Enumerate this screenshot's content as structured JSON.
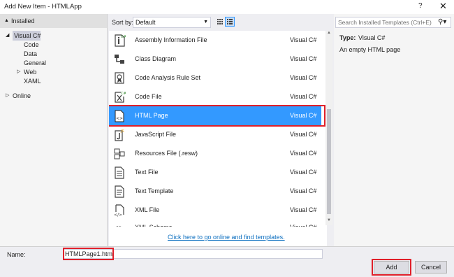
{
  "window": {
    "title": "Add New Item - HTMLApp",
    "help": "?",
    "close": "✕"
  },
  "left": {
    "header": "Installed",
    "tree": [
      {
        "label": "Visual C#",
        "expander": "◢",
        "selected": true
      },
      {
        "label": "Code"
      },
      {
        "label": "Data"
      },
      {
        "label": "General"
      },
      {
        "label": "Web",
        "expander": "▷"
      },
      {
        "label": "XAML"
      }
    ],
    "online": {
      "label": "Online",
      "expander": "▷"
    }
  },
  "toolbar": {
    "sort_label": "Sort by:",
    "sort_value": "Default"
  },
  "templates": [
    {
      "name": "Assembly Information File",
      "lang": "Visual C#",
      "icon": "assembly-info-icon"
    },
    {
      "name": "Class Diagram",
      "lang": "Visual C#",
      "icon": "class-diagram-icon"
    },
    {
      "name": "Code Analysis Rule Set",
      "lang": "Visual C#",
      "icon": "rule-set-icon"
    },
    {
      "name": "Code File",
      "lang": "Visual C#",
      "icon": "code-file-icon"
    },
    {
      "name": "HTML Page",
      "lang": "Visual C#",
      "icon": "html-page-icon",
      "selected": true
    },
    {
      "name": "JavaScript File",
      "lang": "Visual C#",
      "icon": "javascript-file-icon"
    },
    {
      "name": "Resources File (.resw)",
      "lang": "Visual C#",
      "icon": "resources-file-icon"
    },
    {
      "name": "Text File",
      "lang": "Visual C#",
      "icon": "text-file-icon"
    },
    {
      "name": "Text Template",
      "lang": "Visual C#",
      "icon": "text-template-icon"
    },
    {
      "name": "XML File",
      "lang": "Visual C#",
      "icon": "xml-file-icon"
    },
    {
      "name": "XML Schema",
      "lang": "Visual C#",
      "icon": "xml-schema-icon"
    }
  ],
  "online_link": "Click here to go online and find templates.",
  "right": {
    "search_placeholder": "Search Installed Templates (Ctrl+E)",
    "type_label": "Type:",
    "type_value": "Visual C#",
    "description": "An empty HTML page"
  },
  "bottom": {
    "name_label": "Name:",
    "name_value": "HTMLPage1.html",
    "add_label": "Add",
    "cancel_label": "Cancel"
  }
}
